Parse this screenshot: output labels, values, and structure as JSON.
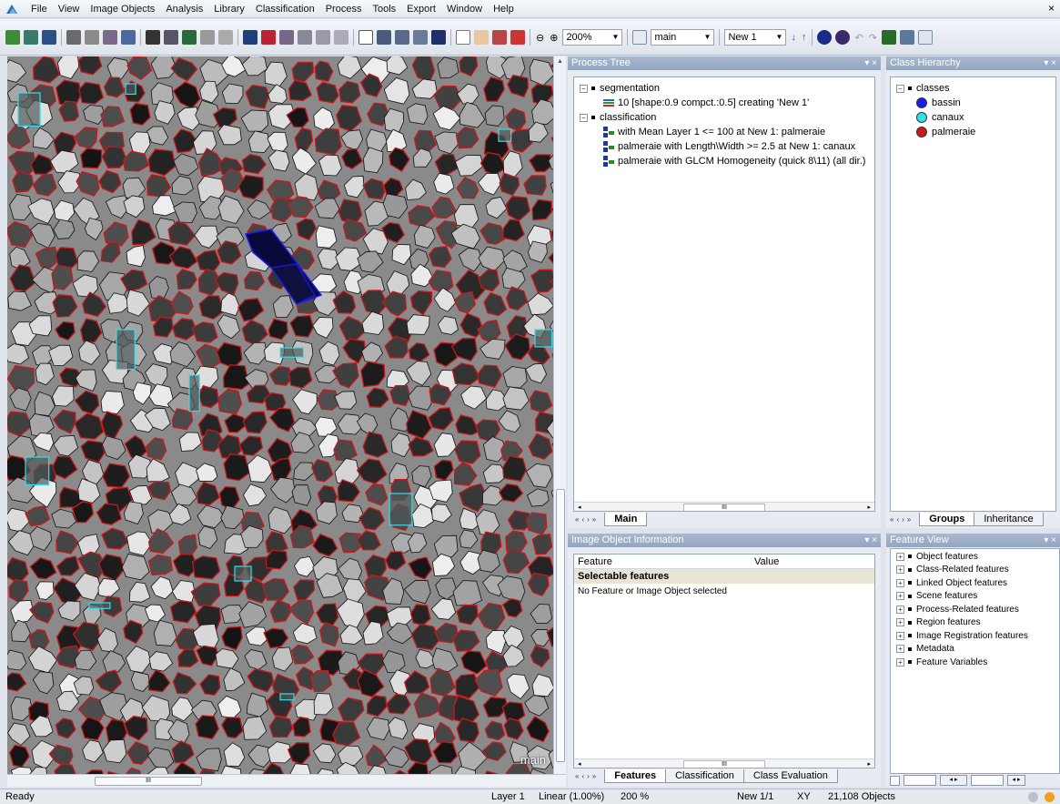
{
  "menu": {
    "items": [
      "File",
      "View",
      "Image Objects",
      "Analysis",
      "Library",
      "Classification",
      "Process",
      "Tools",
      "Export",
      "Window",
      "Help"
    ],
    "close_glyph": "×"
  },
  "toolbar": {
    "zoom_value": "200%",
    "map_value": "main",
    "level_value": "New 1"
  },
  "image_view": {
    "view_label": "main",
    "scroll_marker": "III"
  },
  "process_tree": {
    "title": "Process Tree",
    "controls": "▾ ×",
    "items": [
      {
        "text": "segmentation",
        "kind": "folder",
        "level": 0
      },
      {
        "text": "10 [shape:0.9 compct.:0.5] creating 'New 1'",
        "kind": "process",
        "level": 1
      },
      {
        "text": "classification",
        "kind": "folder",
        "level": 0
      },
      {
        "text": "with Mean Layer 1 <= 100  at  New 1: palmeraie",
        "kind": "process",
        "level": 1
      },
      {
        "text": "palmeraie with Length\\Width >= 2.5  at  New 1: canaux",
        "kind": "process",
        "level": 1
      },
      {
        "text": "palmeraie with GLCM Homogeneity (quick 8\\11) (all dir.)",
        "kind": "process",
        "level": 1
      }
    ],
    "scroll_marker": "III",
    "tabs": [
      "Main"
    ]
  },
  "class_hierarchy": {
    "title": "Class Hierarchy",
    "controls": "▾ ×",
    "root": "classes",
    "classes": [
      {
        "name": "bassin",
        "color": "#1a1aee"
      },
      {
        "name": "canaux",
        "color": "#33e0ea"
      },
      {
        "name": "palmeraie",
        "color": "#c8181c"
      }
    ],
    "tabs": [
      "Groups",
      "Inheritance"
    ]
  },
  "image_object_info": {
    "title": "Image Object Information",
    "controls": "▾ ×",
    "col_feature": "Feature",
    "col_value": "Value",
    "section": "Selectable features",
    "empty_message": "No Feature or Image Object selected",
    "scroll_marker": "III",
    "tabs": [
      "Features",
      "Classification",
      "Class Evaluation"
    ]
  },
  "feature_view": {
    "title": "Feature View",
    "controls": "▾ ×",
    "items": [
      "Object features",
      "Class-Related features",
      "Linked Object features",
      "Scene features",
      "Process-Related features",
      "Region features",
      "Image Registration features",
      "Metadata",
      "Feature Variables"
    ]
  },
  "status": {
    "left": "Ready",
    "layer": "Layer 1",
    "stretch": "Linear (1.00%)",
    "zoom": "200 %",
    "level": "New 1/1",
    "coord": "XY",
    "objects": "21,108 Objects"
  }
}
